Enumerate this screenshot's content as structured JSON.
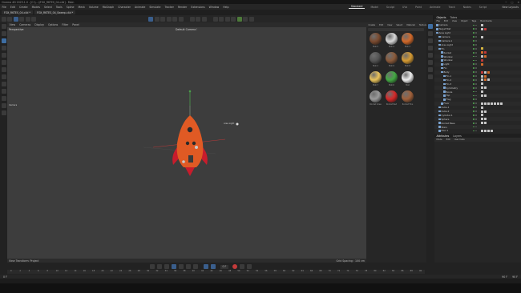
{
  "window": {
    "title": "Cinema 4D 2023.1.0 - [C:\\\\...\\\\FOX_RKTES_04.c4d] - Main"
  },
  "menubar": {
    "items": [
      "File",
      "Edit",
      "Create",
      "Modes",
      "Select",
      "Tools",
      "Spline",
      "Mesh",
      "Volume",
      "MoGraph",
      "Character",
      "Animate",
      "Simulate",
      "Tracker",
      "Render",
      "Extensions",
      "Window",
      "Help"
    ]
  },
  "layouts": {
    "items": [
      "Standard",
      "Model",
      "Sculpt",
      "UVs",
      "Paint",
      "Animate",
      "Track",
      "Nodes",
      "Script"
    ],
    "active": "Standard",
    "new_layouts": "New Layouts"
  },
  "doc_tabs": [
    "FOX_RKTES_04.c4d *",
    "FOX_RKTES_04_Sweep.c4d *"
  ],
  "viewport": {
    "menu": [
      "View",
      "Cameras",
      "Display",
      "Options",
      "Filter",
      "Panel"
    ],
    "label": "Perspective",
    "camera": "Default Camera ⁝",
    "grid_spacing": "Grid Spacing : 100 cm",
    "view_transform": "View Transform: Project",
    "light_label": "Area Light",
    "null_label": "Camera",
    "rocket_body_color": "#e05a24",
    "rocket_fin_color": "#c81c2c",
    "axis_x": "#b83a3a",
    "axis_y": "#4a9d4a"
  },
  "assets": {
    "menu": [
      "Create",
      "Edit",
      "View",
      "Select",
      "Material",
      "Texture"
    ],
    "items": [
      {
        "label": "Mat.5",
        "color": "#7a4a2f"
      },
      {
        "label": "Mat.4",
        "color": "#d8d8d8"
      },
      {
        "label": "Mat.3",
        "color": "#d2692a"
      },
      {
        "label": "Mat.2",
        "color": "#555555"
      },
      {
        "label": "Mat.9",
        "color": "#8a5a3a"
      },
      {
        "label": "Mat.8",
        "color": "#d59a32"
      },
      {
        "label": "Mat.7",
        "color": "#e8c25a"
      },
      {
        "label": "Mat.6",
        "color": "#43a843"
      },
      {
        "label": "Mat",
        "color": "#eeeeee"
      },
      {
        "label": "Rocket Gree",
        "color": "#9a9a9a"
      },
      {
        "label": "Rocket Red",
        "color": "#d62828"
      },
      {
        "label": "Rocket Fins",
        "color": "#a0603a"
      }
    ]
  },
  "objects": {
    "tabs": [
      "Objects",
      "Takes"
    ],
    "menu": [
      "File",
      "Edit",
      "View",
      "Object",
      "Tags",
      "Bookmarks"
    ],
    "rows": [
      {
        "name": "Camera",
        "depth": 0,
        "tags": [
          "w"
        ]
      },
      {
        "name": "Target Mat",
        "depth": 0,
        "tags": [
          "w",
          "r"
        ]
      },
      {
        "name": "Area Light",
        "depth": 0,
        "tags": []
      },
      {
        "name": "Camera",
        "depth": 1,
        "tags": [
          "w"
        ]
      },
      {
        "name": "Camera.1",
        "depth": 1,
        "tags": []
      },
      {
        "name": "Area Light",
        "depth": 1,
        "tags": []
      },
      {
        "name": "Fin",
        "depth": 1,
        "tags": [
          "y"
        ]
      },
      {
        "name": "Rocket",
        "depth": 2,
        "tags": [
          "o",
          "r"
        ]
      },
      {
        "name": "Window",
        "depth": 2,
        "tags": [
          "w",
          "o"
        ]
      },
      {
        "name": "Window",
        "depth": 2,
        "tags": [
          "r"
        ]
      },
      {
        "name": "Light",
        "depth": 2,
        "tags": [
          "o"
        ]
      },
      {
        "name": "Fin",
        "depth": 2,
        "tags": []
      },
      {
        "name": "Body",
        "depth": 2,
        "tags": [
          "r",
          "w",
          "o"
        ]
      },
      {
        "name": "Fin.1",
        "depth": 3,
        "tags": [
          "w",
          "o"
        ]
      },
      {
        "name": "Fin.2",
        "depth": 3,
        "tags": [
          "w",
          "o",
          "w"
        ]
      },
      {
        "name": "Fin.3",
        "depth": 3,
        "tags": [
          "w"
        ]
      },
      {
        "name": "Symmetry",
        "depth": 3,
        "tags": [
          "w",
          "w"
        ]
      },
      {
        "name": "Boole",
        "depth": 3,
        "tags": [
          "w"
        ]
      },
      {
        "name": "Top",
        "depth": 3,
        "tags": [
          "w",
          "w"
        ]
      },
      {
        "name": "Flag",
        "depth": 3,
        "tags": []
      },
      {
        "name": "Floor",
        "depth": 2,
        "tags": [
          "w",
          "w",
          "w",
          "w",
          "w",
          "w",
          "w"
        ]
      },
      {
        "name": "Cube.1",
        "depth": 1,
        "tags": [
          "w"
        ]
      },
      {
        "name": "Cube.2",
        "depth": 1,
        "tags": [
          "w",
          "w"
        ]
      },
      {
        "name": "Cylinder.1",
        "depth": 1,
        "tags": [
          "w"
        ]
      },
      {
        "name": "Sphere",
        "depth": 1,
        "tags": [
          "w",
          "w"
        ]
      },
      {
        "name": "Rocket Base",
        "depth": 1,
        "tags": [
          "w",
          "w"
        ]
      },
      {
        "name": "Stars",
        "depth": 1,
        "tags": []
      },
      {
        "name": "Disc.1",
        "depth": 1,
        "tags": [
          "w",
          "w",
          "w",
          "w"
        ]
      }
    ]
  },
  "attributes": {
    "tabs": [
      "Attributes",
      "Layers"
    ],
    "menu": [
      "Mode",
      "Edit",
      "User Data"
    ]
  },
  "timeline": {
    "ticks": [
      "0",
      "2",
      "4",
      "6",
      "8",
      "10",
      "12",
      "14",
      "16",
      "18",
      "20",
      "22",
      "24",
      "26",
      "28",
      "30",
      "32",
      "34",
      "36",
      "38",
      "40",
      "42",
      "44",
      "46",
      "48",
      "50",
      "52",
      "54",
      "56",
      "58",
      "60",
      "62",
      "64",
      "66",
      "68",
      "70",
      "72",
      "74",
      "76",
      "78",
      "80",
      "82",
      "84",
      "86",
      "88",
      "90"
    ],
    "start": "0 F",
    "end": "90 F",
    "current": "0 F",
    "range_end": "90 F"
  }
}
